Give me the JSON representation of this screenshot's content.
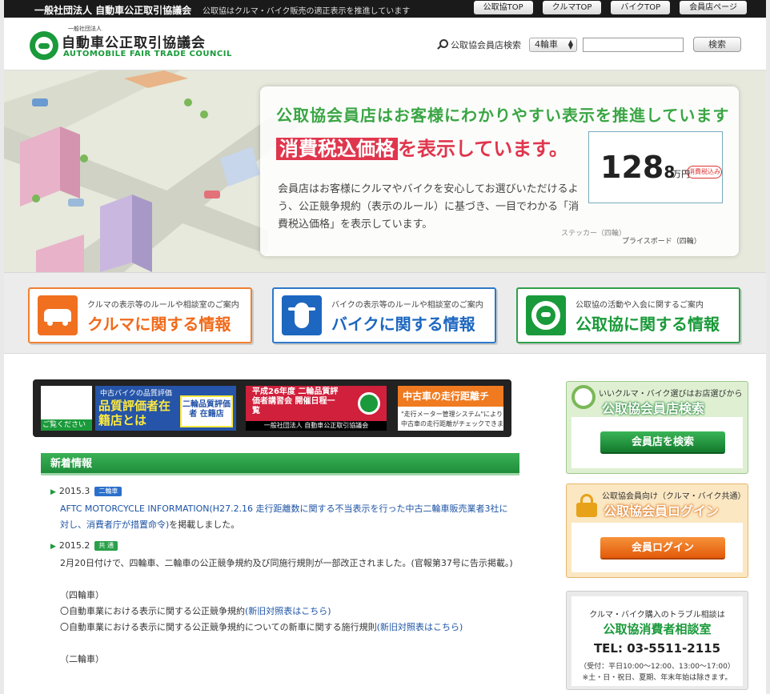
{
  "topbar": {
    "org": "一般社団法人 自動車公正取引協議会",
    "tagline": "公取協はクルマ・バイク販売の適正表示を推進しています",
    "links": [
      "公取協TOP",
      "クルマTOP",
      "バイクTOP",
      "会員店ページ"
    ]
  },
  "header": {
    "logo_small": "一般社団法人",
    "logo_jp": "自動車公正取引協議会",
    "logo_en": "AUTOMOBILE FAIR TRADE COUNCIL",
    "search_label": "公取協会員店検索",
    "select_value": "4輪車",
    "search_button": "検索"
  },
  "hero": {
    "headline1": "公取協会員店はお客様にわかりやすい表示を推進しています",
    "headline2_highlight": "消費税込価格",
    "headline2_rest": "を表示しています。",
    "body": "会員店はお客様にクルマやバイクを安心してお選びいただけるよう、公正競争規約（表示のルール）に基づき、一目でわかる「消費税込価格」を表示しています。",
    "price": "128",
    "price_decimal": "8",
    "price_unit": "万円",
    "price_tag": "消費税込み",
    "sticker_caption": "ステッカー（四輪）",
    "board_caption": "プライスボード（四輪）"
  },
  "categories": [
    {
      "sub": "クルマの表示等のルールや相談室のご案内",
      "main": "クルマに関する情報"
    },
    {
      "sub": "バイクの表示等のルールや相談室のご案内",
      "main": "バイクに関する情報"
    },
    {
      "sub": "公取協の活動や入会に関するご案内",
      "main": "公取協に関する情報"
    }
  ],
  "banners": {
    "b1_caption": "ご覧ください",
    "b2_top": "中古バイクの品質評価",
    "b2_main": "品質評価者在籍店とは",
    "b2_box": "二輪品質評価者 在籍店",
    "b3_main": "平成26年度 二輪品質評価者講習会 開催日程一覧",
    "b3_foot": "一般社団法人 自動車公正取引協議会",
    "b4_head": "中古車の走行距離チ",
    "b4_text1": "\"走行メーター管理システム\"により",
    "b4_text2": "中古車の走行距離がチェックできます"
  },
  "news": {
    "title": "新着情報",
    "items": [
      {
        "date": "2015.3",
        "badge": "二輪車",
        "text": "AFTC MOTORCYCLE INFORMATION(H27.2.16 走行距離数に関する不当表示を行った中古二輪車販売業者3社に対し、消費者庁が措置命令)",
        "suffix": "を掲載しました。"
      },
      {
        "date": "2015.2",
        "badge": "共 通",
        "text": "2月20日付けで、四輪車、二輪車の公正競争規約及び同施行規則が一部改正されました。(官報第37号に告示掲載。)",
        "four_wheel_label": "（四輪車）",
        "rule1": "〇自動車業における表示に関する公正競争規約",
        "rule1_link": "(新旧対照表はこちら)",
        "rule2": "〇自動車業における表示に関する公正競争規約についての新車に関する施行規則",
        "rule2_link": "(新旧対照表はこちら)",
        "two_wheel_label": "（二輪車）"
      }
    ]
  },
  "sidebar": {
    "search_sub": "いいクルマ・バイク選びはお店選びから",
    "search_title": "公取協会員店検索",
    "search_button": "会員店を検索",
    "login_sub": "公取協会員向け（クルマ・バイク共通）",
    "login_title": "公取協会員ログイン",
    "login_button": "会員ログイン",
    "consult_l1": "クルマ・バイク購入のトラブル相談は",
    "consult_l2": "公取協消費者相談室",
    "consult_tel": "TEL: 03-5511-2115",
    "consult_hours": "（受付：平日10:00〜12:00、13:00〜17:00）",
    "consult_note": "※土・日・祝日、夏期、年末年始は除きます。"
  },
  "colors": {
    "brand_green": "#1a9a3a",
    "car_orange": "#f06a1a",
    "bike_blue": "#1d67c0",
    "price_red": "#e0364d",
    "link_blue": "#1d53a5"
  }
}
